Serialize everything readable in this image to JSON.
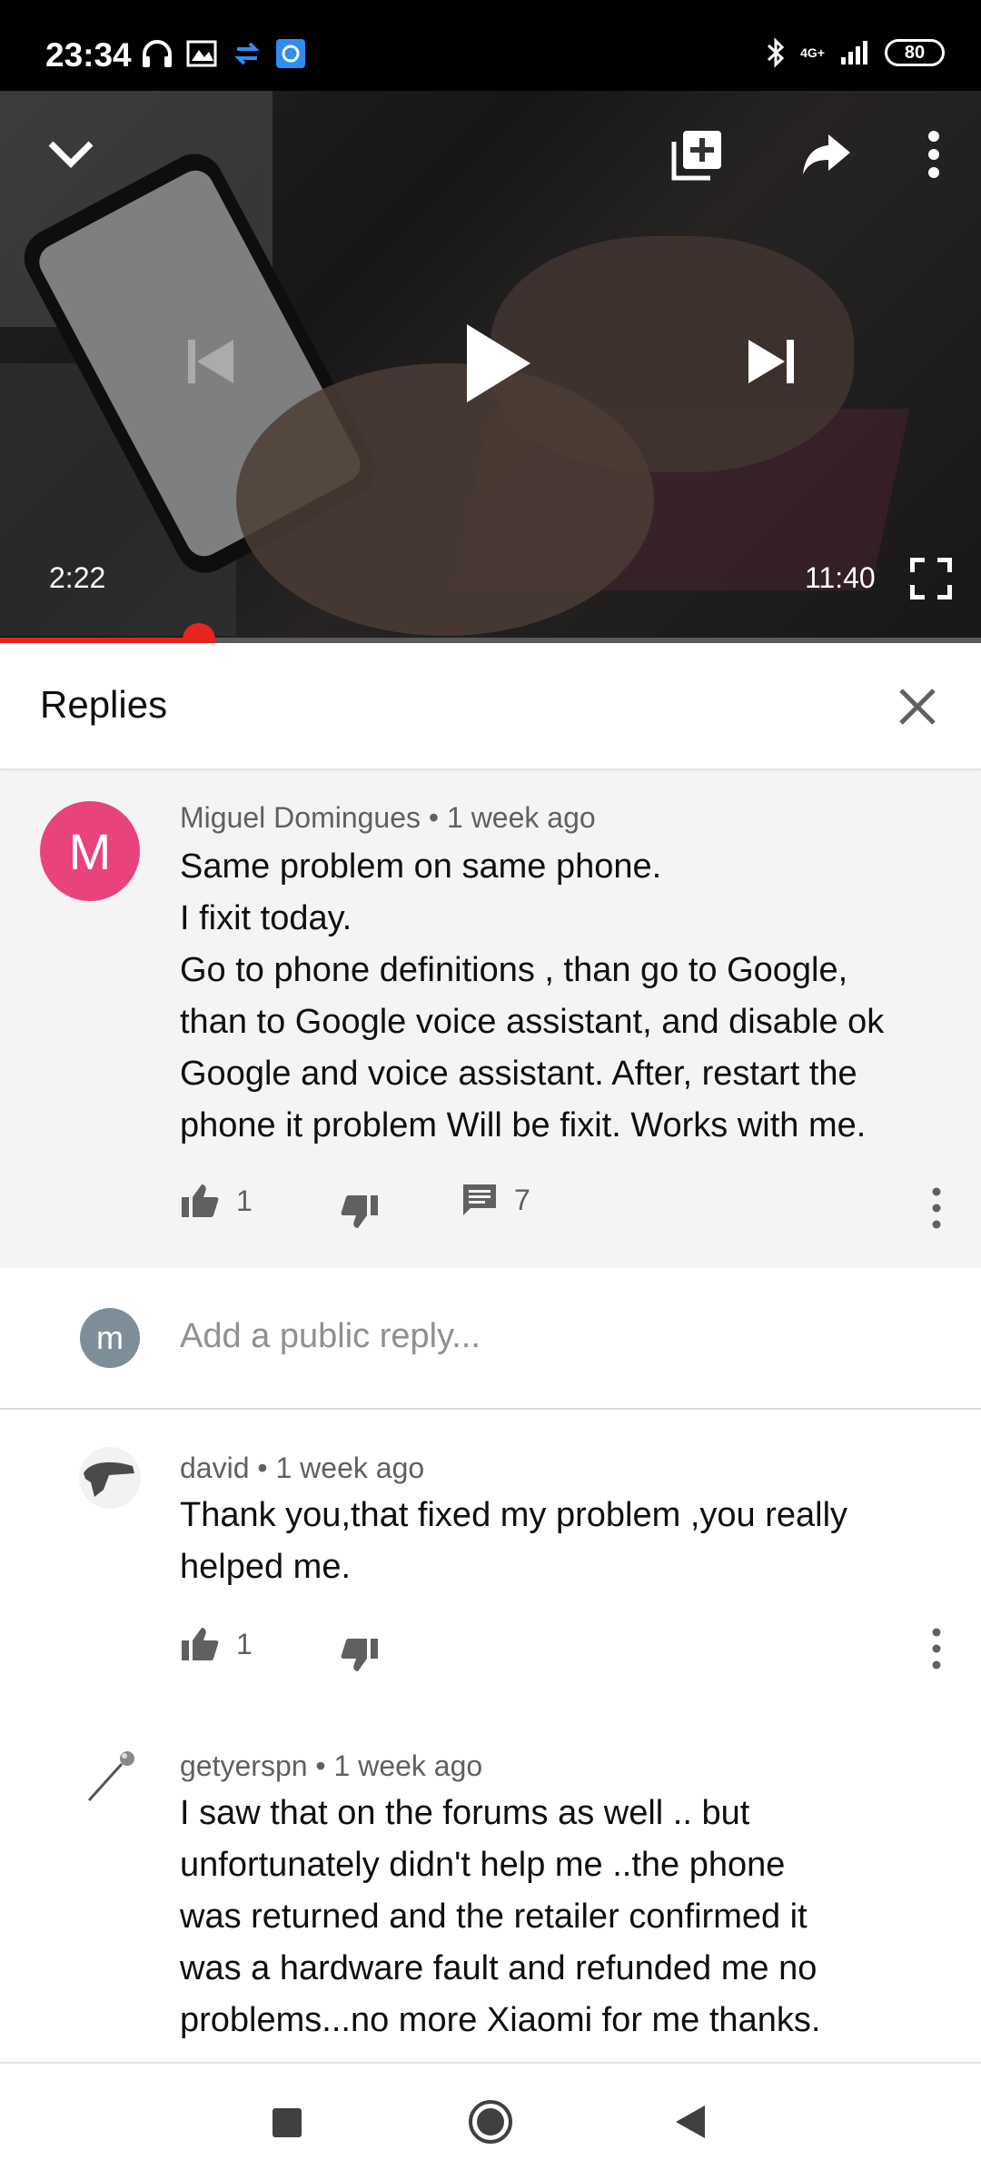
{
  "status_bar": {
    "time": "23:34",
    "network": "4G+",
    "battery": "80"
  },
  "player": {
    "current_time": "2:22",
    "duration": "11:40",
    "progress_fraction": 0.203
  },
  "replies_panel": {
    "title": "Replies"
  },
  "main_comment": {
    "avatar_letter": "M",
    "avatar_color": "#e8437a",
    "author": "Miguel Domingues",
    "age": "1 week ago",
    "lines": [
      "Same problem on same phone.",
      "I fixit today.",
      "Go to phone definitions , than go to Google,",
      "than to Google voice assistant, and disable ok",
      "Google and voice assistant. After, restart the",
      "phone it problem Will be fixit. Works with me."
    ],
    "likes": "1",
    "reply_count": "7"
  },
  "reply_input": {
    "avatar_letter": "m",
    "placeholder": "Add a public reply..."
  },
  "replies": [
    {
      "author": "david",
      "age": "1 week ago",
      "lines": [
        "Thank you,that fixed my problem ,you really",
        "helped me."
      ],
      "likes": "1"
    },
    {
      "author": "getyerspn",
      "age": "1 week ago",
      "lines": [
        "I saw that on the forums as well .. but",
        "unfortunately didn't help me ..the phone",
        "was returned and the retailer confirmed it",
        "was a hardware fault and refunded me no",
        "problems...no more Xiaomi for me thanks."
      ]
    }
  ],
  "colors": {
    "progress": "#e52520",
    "comment_background": "#f4f4f4"
  }
}
